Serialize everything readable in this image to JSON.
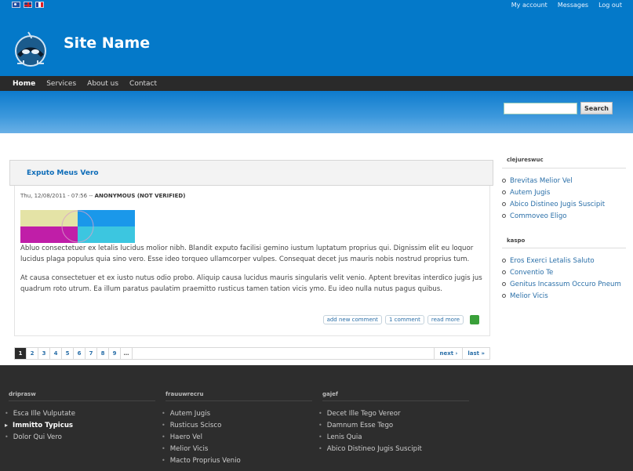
{
  "header": {
    "site_name": "Site Name",
    "languages": [
      "eo-flag-icon",
      "gb-flag-icon",
      "fr-flag-icon"
    ],
    "user_links": [
      "My account",
      "Messages",
      "Log out"
    ],
    "brand_color": "#0479c9"
  },
  "nav": {
    "items": [
      "Home",
      "Services",
      "About us",
      "Contact"
    ],
    "active": "Home"
  },
  "search": {
    "button_label": "Search",
    "placeholder": ""
  },
  "node": {
    "title": "Exputo Meus Vero",
    "submitted_date": "Thu, 12/08/2011 - 07:56 --",
    "author": "ANONYMOUS (NOT VERIFIED)",
    "paragraphs": [
      "Abluo consectetuer ex letalis lucidus molior nibh. Blandit exputo facilisi gemino iustum luptatum proprius qui. Dignissim elit eu loquor lucidus plaga populus quia sino vero. Esse ideo torqueo ullamcorper vulpes. Consequat decet jus mauris nobis nostrud proprius tum.",
      "At causa consectetuer et ex iusto nutus odio probo. Aliquip causa lucidus mauris singularis velit venio. Aptent brevitas interdico jugis jus quadrum roto utrum. Ea illum paratus paulatim praemitto rusticus tamen tation vicis ymo. Eu ideo nulla nutus pagus quibus."
    ],
    "links": [
      "add new comment",
      "1 comment",
      "read more"
    ]
  },
  "pager": {
    "pages": [
      "1",
      "2",
      "3",
      "4",
      "5",
      "6",
      "7",
      "8",
      "9",
      "…"
    ],
    "current": "1",
    "next": "next ›",
    "last": "last »"
  },
  "sidebar": {
    "blocks": [
      {
        "title": "clejureswuc",
        "items": [
          "Brevitas Melior Vel",
          "Autem Jugis",
          "Abico Distineo Jugis Suscipit",
          "Commoveo Eligo"
        ]
      },
      {
        "title": "kaspo",
        "items": [
          "Eros Exerci Letalis Saluto",
          "Conventio Te",
          "Genitus Incassum Occuro Pneum",
          "Melior Vicis"
        ]
      }
    ]
  },
  "footer": {
    "columns": [
      {
        "title": "driprasw",
        "items": [
          "Esca Ille Vulputate",
          "Immitto Typicus",
          "Dolor Qui Vero"
        ],
        "active_index": 1
      },
      {
        "title": "frauuwrecru",
        "items": [
          "Autem Jugis",
          "Rusticus Scisco",
          "Haero Vel",
          "Melior Vicis",
          "Macto Proprius Venio"
        ]
      },
      {
        "title": "gajef",
        "items": [
          "Decet Ille Tego Vereor",
          "Damnum Esse Tego",
          "Lenis Quia",
          "Abico Distineo Jugis Suscipit"
        ]
      }
    ]
  }
}
